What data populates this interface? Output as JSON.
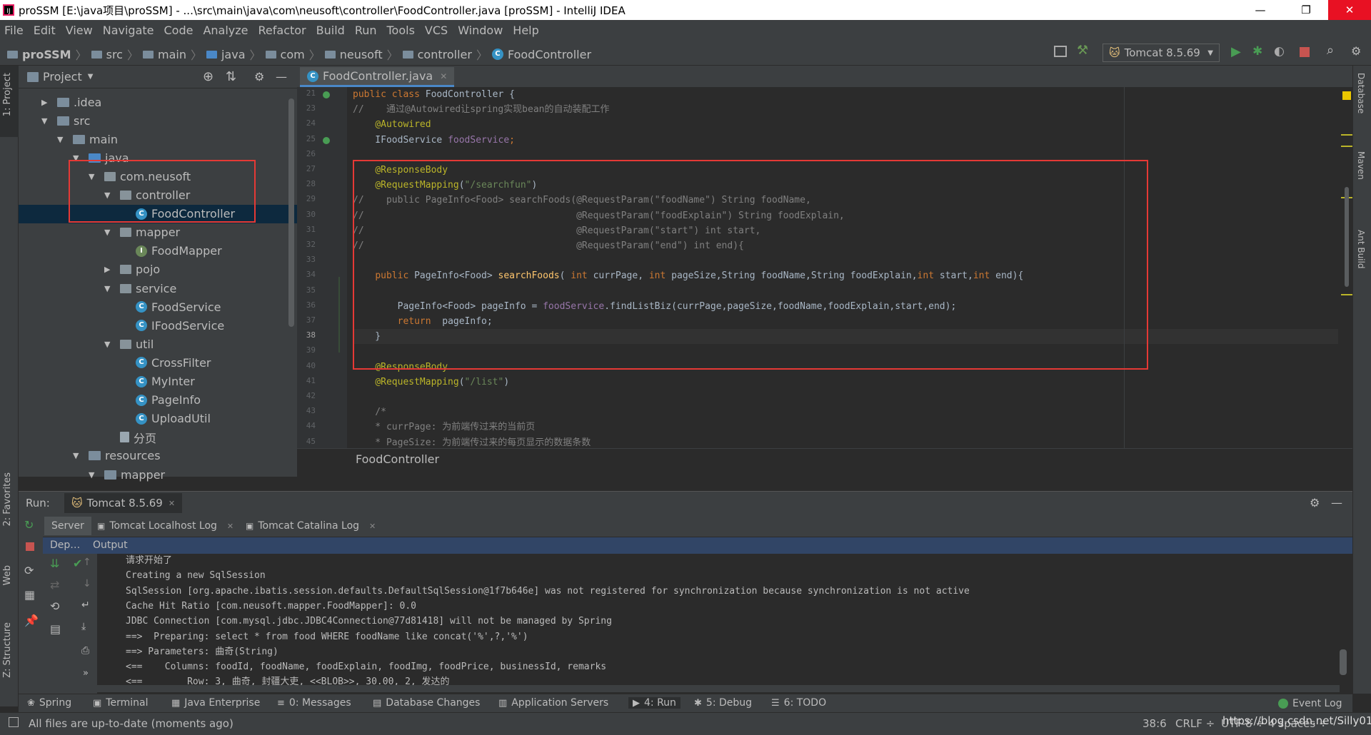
{
  "window": {
    "title": "proSSM [E:\\java项目\\proSSM] - ...\\src\\main\\java\\com\\neusoft\\controller\\FoodController.java [proSSM] - IntelliJ IDEA",
    "minimize": "—",
    "restore": "❐",
    "close": "✕"
  },
  "menu": [
    "File",
    "Edit",
    "View",
    "Navigate",
    "Code",
    "Analyze",
    "Refactor",
    "Build",
    "Run",
    "Tools",
    "VCS",
    "Window",
    "Help"
  ],
  "breadcrumbs": [
    "proSSM",
    "src",
    "main",
    "java",
    "com",
    "neusoft",
    "controller",
    "FoodController"
  ],
  "toolbar": {
    "run_config": "Tomcat 8.5.69"
  },
  "left_tabs": {
    "project": "1: Project",
    "favorites": "2: Favorites",
    "web": "Web",
    "structure": "Z: Structure"
  },
  "right_tabs": {
    "database": "Database",
    "maven": "Maven",
    "ant": "Ant Build"
  },
  "project": {
    "header": "Project",
    "tree": [
      {
        "label": ".idea",
        "depth": 1,
        "kind": "folder",
        "arrow": "▶"
      },
      {
        "label": "src",
        "depth": 1,
        "kind": "folder",
        "arrow": "▼"
      },
      {
        "label": "main",
        "depth": 2,
        "kind": "folder",
        "arrow": "▼"
      },
      {
        "label": "java",
        "depth": 3,
        "kind": "folder-src",
        "arrow": "▼"
      },
      {
        "label": "com.neusoft",
        "depth": 4,
        "kind": "package",
        "arrow": "▼"
      },
      {
        "label": "controller",
        "depth": 5,
        "kind": "package",
        "arrow": "▼"
      },
      {
        "label": "FoodController",
        "depth": 6,
        "kind": "class",
        "arrow": "",
        "selected": true
      },
      {
        "label": "mapper",
        "depth": 5,
        "kind": "package",
        "arrow": "▼"
      },
      {
        "label": "FoodMapper",
        "depth": 6,
        "kind": "interface",
        "arrow": ""
      },
      {
        "label": "pojo",
        "depth": 5,
        "kind": "package",
        "arrow": "▶"
      },
      {
        "label": "service",
        "depth": 5,
        "kind": "package",
        "arrow": "▼"
      },
      {
        "label": "FoodService",
        "depth": 6,
        "kind": "class",
        "arrow": ""
      },
      {
        "label": "IFoodService",
        "depth": 6,
        "kind": "class",
        "arrow": ""
      },
      {
        "label": "util",
        "depth": 5,
        "kind": "package",
        "arrow": "▼"
      },
      {
        "label": "CrossFilter",
        "depth": 6,
        "kind": "class",
        "arrow": ""
      },
      {
        "label": "MyInter",
        "depth": 6,
        "kind": "class",
        "arrow": ""
      },
      {
        "label": "PageInfo",
        "depth": 6,
        "kind": "class",
        "arrow": ""
      },
      {
        "label": "UploadUtil",
        "depth": 6,
        "kind": "class",
        "arrow": ""
      },
      {
        "label": "分页",
        "depth": 5,
        "kind": "file",
        "arrow": ""
      },
      {
        "label": "resources",
        "depth": 3,
        "kind": "folder",
        "arrow": "▼"
      },
      {
        "label": "mapper",
        "depth": 4,
        "kind": "folder",
        "arrow": "▼"
      }
    ]
  },
  "editor": {
    "tab": "FoodController.java",
    "footer_breadcrumb": "FoodController",
    "line_numbers": [
      "21",
      "23",
      "24",
      "25",
      "26",
      "27",
      "28",
      "29",
      "30",
      "31",
      "32",
      "33",
      "34",
      "35",
      "36",
      "37",
      "38",
      "39",
      "40",
      "41",
      "42",
      "43",
      "44",
      "45"
    ],
    "lines": [
      [
        {
          "t": "public class ",
          "c": "kw"
        },
        {
          "t": "FoodController {",
          "c": ""
        }
      ],
      [
        {
          "t": "//    通过@Autowired让spring实现bean的自动装配工作",
          "c": "cm"
        }
      ],
      [
        {
          "t": "    ",
          "c": ""
        },
        {
          "t": "@Autowired",
          "c": "an"
        }
      ],
      [
        {
          "t": "    IFoodService ",
          "c": ""
        },
        {
          "t": "foodService",
          "c": "fd"
        },
        {
          "t": ";",
          "c": "kw"
        }
      ],
      [],
      [
        {
          "t": "    ",
          "c": ""
        },
        {
          "t": "@ResponseBody",
          "c": "an"
        }
      ],
      [
        {
          "t": "    ",
          "c": ""
        },
        {
          "t": "@RequestMapping",
          "c": "an"
        },
        {
          "t": "(",
          "c": ""
        },
        {
          "t": "\"/searchfun\"",
          "c": "st"
        },
        {
          "t": ")",
          "c": ""
        }
      ],
      [
        {
          "t": "//    public PageInfo<Food> searchFoods(@RequestParam(\"foodName\") String foodName,",
          "c": "cm"
        }
      ],
      [
        {
          "t": "//                                      @RequestParam(\"foodExplain\") String foodExplain,",
          "c": "cm"
        }
      ],
      [
        {
          "t": "//                                      @RequestParam(\"start\") int start,",
          "c": "cm"
        }
      ],
      [
        {
          "t": "//                                      @RequestParam(\"end\") int end){",
          "c": "cm"
        }
      ],
      [],
      [
        {
          "t": "    ",
          "c": ""
        },
        {
          "t": "public ",
          "c": "kw"
        },
        {
          "t": "PageInfo<Food> ",
          "c": ""
        },
        {
          "t": "searchFoods",
          "c": "fn"
        },
        {
          "t": "( ",
          "c": ""
        },
        {
          "t": "int ",
          "c": "kw"
        },
        {
          "t": "currPage, ",
          "c": ""
        },
        {
          "t": "int ",
          "c": "kw"
        },
        {
          "t": "pageSize,String foodName,String foodExplain,",
          "c": ""
        },
        {
          "t": "int ",
          "c": "kw"
        },
        {
          "t": "start,",
          "c": ""
        },
        {
          "t": "int ",
          "c": "kw"
        },
        {
          "t": "end){",
          "c": ""
        }
      ],
      [],
      [
        {
          "t": "        PageInfo<Food> pageInfo = ",
          "c": ""
        },
        {
          "t": "foodService",
          "c": "fd"
        },
        {
          "t": ".findListBiz(currPage,pageSize,foodName,foodExplain,start,end);",
          "c": ""
        }
      ],
      [
        {
          "t": "        ",
          "c": ""
        },
        {
          "t": "return  ",
          "c": "kw"
        },
        {
          "t": "pageInfo;",
          "c": ""
        }
      ],
      [
        {
          "t": "    }",
          "c": ""
        }
      ],
      [],
      [
        {
          "t": "    ",
          "c": ""
        },
        {
          "t": "@ResponseBody",
          "c": "an"
        }
      ],
      [
        {
          "t": "    ",
          "c": ""
        },
        {
          "t": "@RequestMapping",
          "c": "an"
        },
        {
          "t": "(",
          "c": ""
        },
        {
          "t": "\"/list\"",
          "c": "st"
        },
        {
          "t": ")",
          "c": ""
        }
      ],
      [],
      [
        {
          "t": "    /*",
          "c": "cm"
        }
      ],
      [
        {
          "t": "    * currPage: 为前端传过来的当前页",
          "c": "cm"
        }
      ],
      [
        {
          "t": "    * PageSize: 为前端传过来的每页显示的数据条数",
          "c": "cm"
        }
      ]
    ]
  },
  "run": {
    "label": "Run:",
    "config_tab": "Tomcat 8.5.69",
    "tabs": [
      "Server",
      "Tomcat Localhost Log",
      "Tomcat Catalina Log"
    ],
    "deploy_label": "Dep…",
    "output_label": "Output",
    "console": [
      "请求开始了",
      "Creating a new SqlSession",
      "SqlSession [org.apache.ibatis.session.defaults.DefaultSqlSession@1f7b646e] was not registered for synchronization because synchronization is not active",
      "Cache Hit Ratio [com.neusoft.mapper.FoodMapper]: 0.0",
      "JDBC Connection [com.mysql.jdbc.JDBC4Connection@77d81418] will not be managed by Spring",
      "==>  Preparing: select * from food WHERE foodName like concat('%',?,'%')",
      "==> Parameters: 曲奇(String)",
      "<==    Columns: foodId, foodName, foodExplain, foodImg, foodPrice, businessId, remarks",
      "<==        Row: 3, 曲奇, 封疆大吏, <<BLOB>>, 30.00, 2, 发达的"
    ]
  },
  "bottom_tools": [
    {
      "label": "Spring",
      "icon": "spring-icon"
    },
    {
      "label": "Terminal",
      "icon": "terminal-icon"
    },
    {
      "label": "Java Enterprise",
      "icon": "java-enterprise-icon"
    },
    {
      "label": "0: Messages",
      "icon": "messages-icon"
    },
    {
      "label": "Database Changes",
      "icon": "database-changes-icon"
    },
    {
      "label": "Application Servers",
      "icon": "app-servers-icon"
    },
    {
      "label": "4: Run",
      "icon": "run-icon"
    },
    {
      "label": "5: Debug",
      "icon": "debug-icon"
    },
    {
      "label": "6: TODO",
      "icon": "todo-icon"
    }
  ],
  "status": {
    "message": "All files are up-to-date (moments ago)",
    "event_log": "Event Log",
    "position": "38:6",
    "line_sep": "CRLF ÷",
    "encoding": "UTF-8 ÷",
    "indent": "4 spaces ÷",
    "watermark": "https://blog.csdn.net/Silly011"
  }
}
